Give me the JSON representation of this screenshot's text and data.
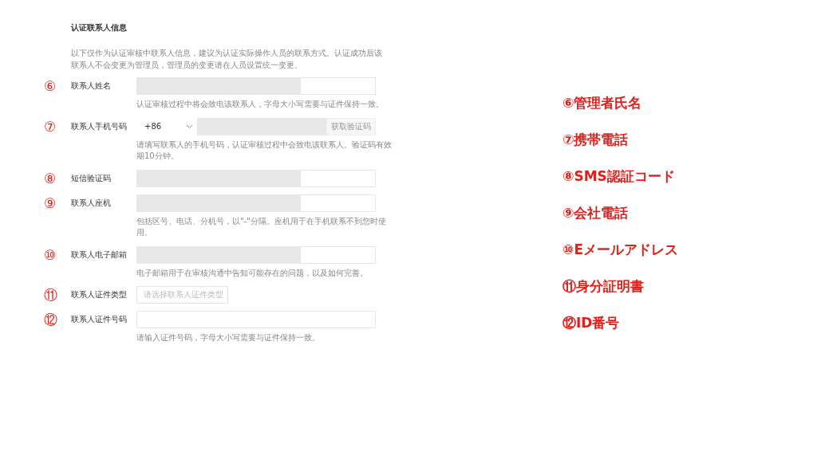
{
  "section": {
    "title": "认证联系人信息",
    "description": "以下仅作为认证审核中联系人信息，建议为认证实际操作人员的联系方式。认证成功后该联系人不会变更为管理员，管理员的变更请在人员设置统一变更。"
  },
  "fields": [
    {
      "marker": "⑥",
      "label": "联系人姓名",
      "kind": "text",
      "redacted": true,
      "help": "认证审核过程中将会致电该联系人，字母大小写需要与证件保持一致。"
    },
    {
      "marker": "⑦",
      "label": "联系人手机号码",
      "kind": "phone",
      "country_code": "+86",
      "redacted": true,
      "button": "获取验证码",
      "help": "请填写联系人的手机号码，认证审核过程中会致电该联系人。验证码有效期10分钟。"
    },
    {
      "marker": "⑧",
      "label": "短信验证码",
      "kind": "text",
      "redacted": true
    },
    {
      "marker": "⑨",
      "label": "联系人座机",
      "kind": "text",
      "redacted": true,
      "help": "包括区号、电话、分机号，以\"-\"分隔。座机用于在手机联系不到您时使用。"
    },
    {
      "marker": "⑩",
      "label": "联系人电子邮箱",
      "kind": "text",
      "redacted": true,
      "help": "电子邮箱用于在审核沟通中告知可能存在的问题，以及如何完善。"
    },
    {
      "marker": "⑪",
      "label": "联系人证件类型",
      "kind": "select",
      "placeholder": "请选择联系人证件类型"
    },
    {
      "marker": "⑫",
      "label": "联系人证件号码",
      "kind": "text",
      "redacted": false,
      "help": "请输入证件号码，字母大小写需要与证件保持一致。"
    }
  ],
  "annotations": [
    "⑥管理者氏名",
    "⑦携帯電話",
    "⑧SMS認証コード",
    "⑨会社電話",
    "⑩Eメールアドレス",
    "⑪身分証明書",
    "⑫ID番号"
  ]
}
